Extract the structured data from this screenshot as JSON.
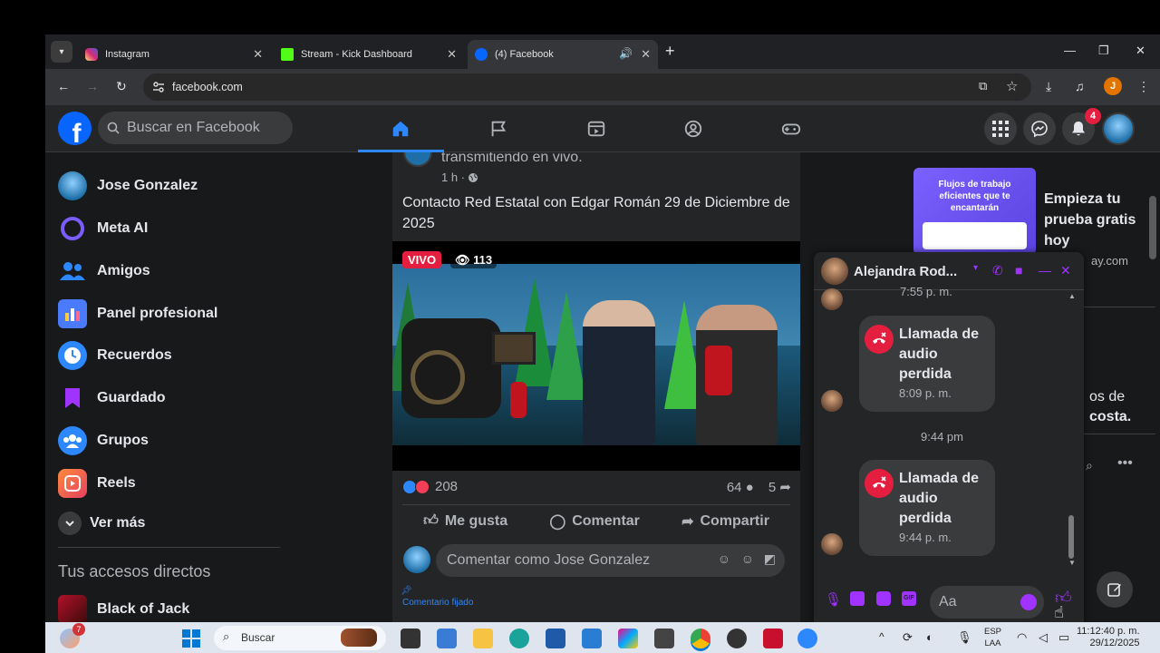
{
  "browser": {
    "tabs": [
      {
        "title": "Instagram",
        "color": "#e1306c"
      },
      {
        "title": "Stream - Kick Dashboard",
        "color": "#53fc18"
      },
      {
        "title": "(4) Facebook",
        "color": "#0866ff"
      }
    ],
    "url": "facebook.com",
    "profile_letter": "J"
  },
  "fb": {
    "search_placeholder": "Buscar en Facebook",
    "notification_count": "4",
    "sidebar": [
      {
        "label": "Jose Gonzalez",
        "icon": "user-avatar-icon",
        "color": "#1e6fa8"
      },
      {
        "label": "Meta AI",
        "icon": "meta-ai-icon",
        "color": "#6a3cff"
      },
      {
        "label": "Amigos",
        "icon": "friends-icon",
        "color": "#2d88ff"
      },
      {
        "label": "Panel profesional",
        "icon": "dashboard-icon",
        "color": "#4a7bff"
      },
      {
        "label": "Recuerdos",
        "icon": "memories-icon",
        "color": "#2d88ff"
      },
      {
        "label": "Guardado",
        "icon": "saved-icon",
        "color": "#a033ff"
      },
      {
        "label": "Grupos",
        "icon": "groups-icon",
        "color": "#2d88ff"
      },
      {
        "label": "Reels",
        "icon": "reels-icon",
        "color": "#e4405f"
      }
    ],
    "see_more": "Ver más",
    "shortcuts_title": "Tus accesos directos",
    "shortcut_item": "Black of Jack"
  },
  "post": {
    "header_text": "transmitiendo en vivo.",
    "time": "1 h ·",
    "body": "Contacto Red Estatal con Edgar Román 29 de Diciembre de 2025",
    "live_label": "VIVO",
    "viewers": "113",
    "reactions": "208",
    "comments": "64",
    "shares": "5",
    "like_label": "Me gusta",
    "comment_label": "Comentar",
    "share_label": "Compartir",
    "comment_placeholder": "Comentar como Jose Gonzalez",
    "pinned_label": "Comentario fijado"
  },
  "ad": {
    "creative_text": "Flujos de trabajo eficientes que te encantarán",
    "title": "Empieza tu prueba gratis hoy",
    "domain": "ay.com",
    "partial_line1": "os de",
    "partial_line2": "costa."
  },
  "chat": {
    "name": "Alejandra Rod...",
    "top_time": "7:55 p. m.",
    "messages": [
      {
        "text": "Llamada de audio perdida",
        "time": "8:09 p. m."
      },
      {
        "text": "Llamada de audio perdida",
        "time": "9:44 p. m."
      }
    ],
    "separator": "9:44 pm",
    "input_placeholder": "Aa"
  },
  "taskbar": {
    "search": "Buscar",
    "lang1": "ESP",
    "lang2": "LAA",
    "time": "11:12:40 p. m.",
    "date": "29/12/2025",
    "widget_badge": "7"
  }
}
